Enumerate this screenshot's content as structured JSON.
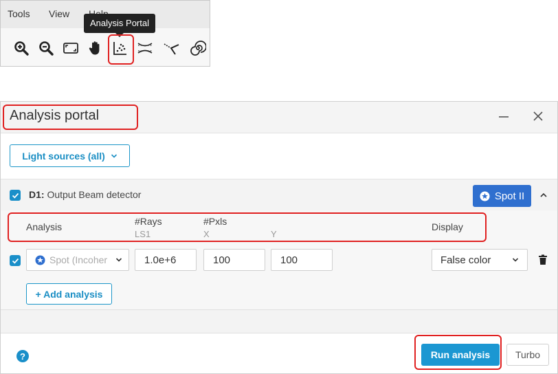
{
  "menu": {
    "tools": "Tools",
    "view": "View",
    "help": "Help"
  },
  "toolbar": {
    "tooltip": "Analysis Portal",
    "icons": [
      "zoom-in-icon",
      "zoom-out-icon",
      "fit-view-icon",
      "pan-hand-icon",
      "analysis-portal-icon",
      "lens-icon",
      "ray-trace-icon",
      "spiral-icon"
    ]
  },
  "portal": {
    "title": "Analysis portal",
    "light_sources_label": "Light sources (all)",
    "detector": {
      "id": "D1:",
      "name": "Output Beam detector",
      "spot_button": "Spot II"
    },
    "columns": {
      "analysis": "Analysis",
      "rays": "#Rays",
      "rays_sub": "LS1",
      "pxls": "#Pxls",
      "pxls_x": "X",
      "pxls_y": "Y",
      "display": "Display"
    },
    "row": {
      "analysis_value": "Spot (Incoher",
      "rays_value": "1.0e+6",
      "pxls_x_value": "100",
      "pxls_y_value": "100",
      "display_value": "False color"
    },
    "add_analysis": "+ Add analysis",
    "help": "?",
    "run_analysis": "Run analysis",
    "turbo": "Turbo"
  },
  "colors": {
    "accent": "#1a8fc9",
    "spot_button": "#2f6fcf",
    "highlight": "#e02020"
  }
}
